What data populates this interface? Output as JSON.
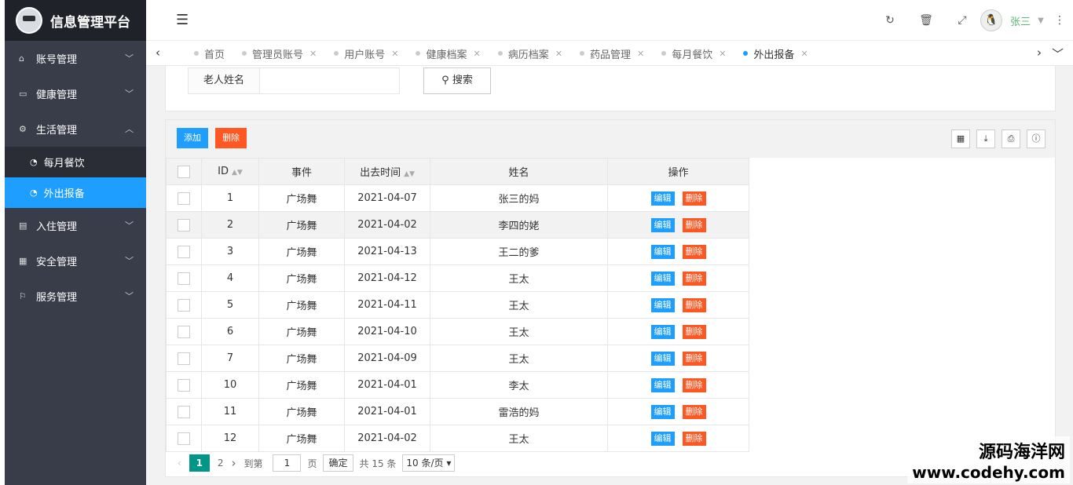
{
  "app": {
    "title": "信息管理平台"
  },
  "sidebar": {
    "items": [
      {
        "label": "账号管理",
        "icon": "home-icon"
      },
      {
        "label": "健康管理",
        "icon": "window-icon"
      },
      {
        "label": "生活管理",
        "icon": "gears-icon",
        "expanded": true,
        "children": [
          {
            "label": "每月餐饮"
          },
          {
            "label": "外出报备",
            "active": true
          }
        ]
      },
      {
        "label": "入住管理",
        "icon": "file-icon"
      },
      {
        "label": "安全管理",
        "icon": "calendar-icon"
      },
      {
        "label": "服务管理",
        "icon": "flag-icon"
      }
    ]
  },
  "topbar": {
    "user": "张三"
  },
  "tabs": [
    {
      "label": "首页"
    },
    {
      "label": "管理员账号"
    },
    {
      "label": "用户账号"
    },
    {
      "label": "健康档案"
    },
    {
      "label": "病历档案"
    },
    {
      "label": "药品管理"
    },
    {
      "label": "每月餐饮"
    },
    {
      "label": "外出报备",
      "active": true
    }
  ],
  "search": {
    "field_label": "老人姓名",
    "field_value": "",
    "button": "搜索"
  },
  "toolbar": {
    "add": "添加",
    "delete": "删除"
  },
  "table": {
    "columns": [
      "ID",
      "事件",
      "出去时间",
      "姓名",
      "操作"
    ],
    "actions": {
      "edit": "编辑",
      "delete": "删除"
    },
    "rows": [
      {
        "id": "1",
        "event": "广场舞",
        "time": "2021-04-07",
        "name": "张三的妈"
      },
      {
        "id": "2",
        "event": "广场舞",
        "time": "2021-04-02",
        "name": "李四的姥"
      },
      {
        "id": "3",
        "event": "广场舞",
        "time": "2021-04-13",
        "name": "王二的爹"
      },
      {
        "id": "4",
        "event": "广场舞",
        "time": "2021-04-12",
        "name": "王太"
      },
      {
        "id": "5",
        "event": "广场舞",
        "time": "2021-04-11",
        "name": "王太"
      },
      {
        "id": "6",
        "event": "广场舞",
        "time": "2021-04-10",
        "name": "王太"
      },
      {
        "id": "7",
        "event": "广场舞",
        "time": "2021-04-09",
        "name": "王太"
      },
      {
        "id": "10",
        "event": "广场舞",
        "time": "2021-04-01",
        "name": "李太"
      },
      {
        "id": "11",
        "event": "广场舞",
        "time": "2021-04-01",
        "name": "雷浩的妈"
      },
      {
        "id": "12",
        "event": "广场舞",
        "time": "2021-04-02",
        "name": "王太"
      }
    ]
  },
  "pager": {
    "pages": [
      "1",
      "2"
    ],
    "current": "1",
    "goto_prefix": "到第",
    "goto_value": "1",
    "goto_suffix": "页",
    "confirm": "确定",
    "total": "共 15 条",
    "per_page": "10 条/页"
  },
  "watermark": {
    "line1": "源码海洋网",
    "line2": "www.codehy.com"
  },
  "colors": {
    "accent": "#1e9fff",
    "danger": "#ff5722",
    "sidebar": "#393d49",
    "pager_active": "#009688"
  }
}
